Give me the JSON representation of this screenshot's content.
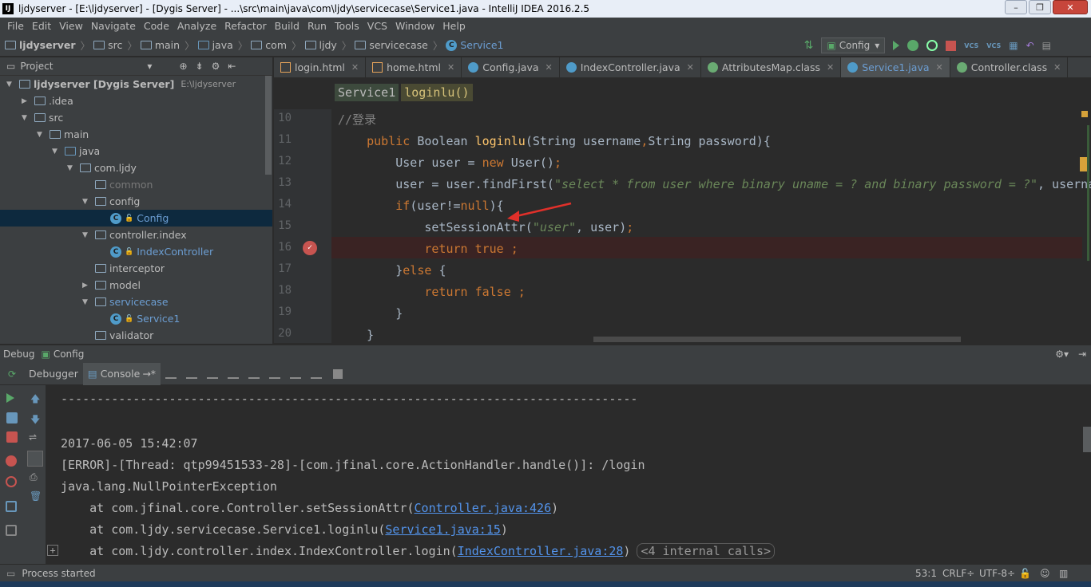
{
  "window": {
    "title": "ljdyserver - [E:\\ljdyserver] - [Dygis Server] - ...\\src\\main\\java\\com\\ljdy\\servicecase\\Service1.java - IntelliJ IDEA 2016.2.5",
    "app_icon": "IJ"
  },
  "menu": [
    "File",
    "Edit",
    "View",
    "Navigate",
    "Code",
    "Analyze",
    "Refactor",
    "Build",
    "Run",
    "Tools",
    "VCS",
    "Window",
    "Help"
  ],
  "breadcrumbs": [
    "ljdyserver",
    "src",
    "main",
    "java",
    "com",
    "ljdy",
    "servicecase",
    "Service1"
  ],
  "run_config": "Config",
  "project_panel": {
    "title": "Project"
  },
  "tree": [
    {
      "label": "ljdyserver [Dygis Server]",
      "extra": "E:\\ljdyserver",
      "indent": 0,
      "arrow": "▼",
      "icon": "folder"
    },
    {
      "label": ".idea",
      "indent": 1,
      "arrow": "▶",
      "icon": "folder"
    },
    {
      "label": "src",
      "indent": 1,
      "arrow": "▼",
      "icon": "folder"
    },
    {
      "label": "main",
      "indent": 2,
      "arrow": "▼",
      "icon": "folder"
    },
    {
      "label": "java",
      "indent": 3,
      "arrow": "▼",
      "icon": "folder-blue"
    },
    {
      "label": "com.ljdy",
      "indent": 4,
      "arrow": "▼",
      "icon": "folder"
    },
    {
      "label": "common",
      "indent": 5,
      "arrow": "",
      "icon": "folder",
      "style": "dim"
    },
    {
      "label": "config",
      "indent": 5,
      "arrow": "▼",
      "icon": "folder"
    },
    {
      "label": "Config",
      "indent": 6,
      "arrow": "",
      "icon": "class",
      "style": "lnk",
      "selected": true
    },
    {
      "label": "controller.index",
      "indent": 5,
      "arrow": "▼",
      "icon": "folder"
    },
    {
      "label": "IndexController",
      "indent": 6,
      "arrow": "",
      "icon": "class",
      "style": "lnk"
    },
    {
      "label": "interceptor",
      "indent": 5,
      "arrow": "",
      "icon": "folder"
    },
    {
      "label": "model",
      "indent": 5,
      "arrow": "▶",
      "icon": "folder"
    },
    {
      "label": "servicecase",
      "indent": 5,
      "arrow": "▼",
      "icon": "folder",
      "style": "lnk"
    },
    {
      "label": "Service1",
      "indent": 6,
      "arrow": "",
      "icon": "class",
      "style": "lnk"
    },
    {
      "label": "validator",
      "indent": 5,
      "arrow": "",
      "icon": "folder"
    }
  ],
  "tabs": [
    {
      "label": "login.html",
      "type": "html"
    },
    {
      "label": "home.html",
      "type": "html"
    },
    {
      "label": "Config.java",
      "type": "java"
    },
    {
      "label": "IndexController.java",
      "type": "java"
    },
    {
      "label": "AttributesMap.class",
      "type": "cls"
    },
    {
      "label": "Service1.java",
      "type": "java",
      "active": true
    },
    {
      "label": "Controller.class",
      "type": "cls"
    }
  ],
  "editor": {
    "crumb_class": "Service1",
    "crumb_method": "loginlu()",
    "line_numbers": [
      "10",
      "11",
      "12",
      "13",
      "14",
      "15",
      "16",
      "17",
      "18",
      "19",
      "20"
    ],
    "lines": [
      [
        {
          "t": "//登录",
          "c": "cm"
        }
      ],
      [
        {
          "t": "    "
        },
        {
          "t": "public ",
          "c": "kw"
        },
        {
          "t": "Boolean ",
          "c": "def"
        },
        {
          "t": "loginlu",
          "c": "fn"
        },
        {
          "t": "(String username",
          "c": "def"
        },
        {
          "t": ",",
          "c": "kw"
        },
        {
          "t": "String password){",
          "c": "def"
        }
      ],
      [
        {
          "t": "        User user = ",
          "c": "def"
        },
        {
          "t": "new ",
          "c": "kw"
        },
        {
          "t": "User()",
          "c": "def"
        },
        {
          "t": ";",
          "c": "kw"
        }
      ],
      [
        {
          "t": "        user = user.findFirst(",
          "c": "def"
        },
        {
          "t": "\"select * from user where binary uname = ? and binary password = ?\"",
          "c": "str"
        },
        {
          "t": ", userna",
          "c": "def"
        }
      ],
      [
        {
          "t": "        ",
          "c": "def"
        },
        {
          "t": "if",
          "c": "kw"
        },
        {
          "t": "(user!=",
          "c": "def"
        },
        {
          "t": "null",
          "c": "kw"
        },
        {
          "t": "){",
          "c": "def"
        }
      ],
      [
        {
          "t": "            setSessionAttr(",
          "c": "def"
        },
        {
          "t": "\"user\"",
          "c": "str"
        },
        {
          "t": ", user)",
          "c": "def"
        },
        {
          "t": ";",
          "c": "kw"
        }
      ],
      [
        {
          "t": "            ",
          "c": "def"
        },
        {
          "t": "return true ;",
          "c": "kw"
        }
      ],
      [
        {
          "t": "        }",
          "c": "def"
        },
        {
          "t": "else ",
          "c": "kw"
        },
        {
          "t": "{",
          "c": "def"
        }
      ],
      [
        {
          "t": "            ",
          "c": "def"
        },
        {
          "t": "return false ;",
          "c": "kw"
        }
      ],
      [
        {
          "t": "        }",
          "c": "def"
        }
      ],
      [
        {
          "t": "    }",
          "c": "def"
        }
      ]
    ]
  },
  "debug": {
    "title": "Debug",
    "config": "Config",
    "tab_debugger": "Debugger",
    "tab_console": "Console"
  },
  "console": {
    "divider": "--------------------------------------------------------------------------------",
    "timestamp": "2017-06-05 15:42:07",
    "error": "[ERROR]-[Thread: qtp99451533-28]-[com.jfinal.core.ActionHandler.handle()]: /login",
    "exception": "java.lang.NullPointerException",
    "trace": [
      {
        "prefix": "    at com.jfinal.core.Controller.setSessionAttr(",
        "link": "Controller.java:426",
        "suffix": ")"
      },
      {
        "prefix": "    at com.ljdy.servicecase.Service1.loginlu(",
        "link": "Service1.java:15",
        "suffix": ")"
      },
      {
        "prefix": "    at com.ljdy.controller.index.IndexController.login(",
        "link": "IndexController.java:28",
        "suffix": ")",
        "internal": "<4 internal calls>"
      }
    ]
  },
  "status": {
    "message": "Process started",
    "position": "53:1",
    "line_sep": "CRLF÷",
    "encoding": "UTF-8÷"
  }
}
